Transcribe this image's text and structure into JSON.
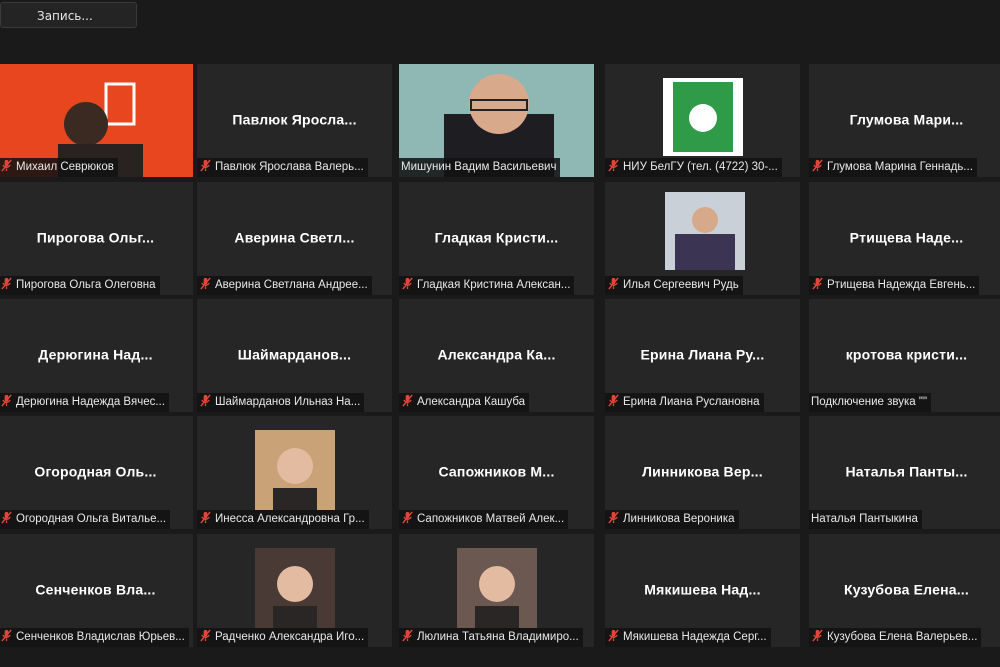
{
  "toolbar": {
    "record_label": "Запись..."
  },
  "colors": {
    "active_speaker": "#bfe23a",
    "tile_bg": "#262626",
    "page_bg": "#1a1a1a",
    "muted_mic": "#e0473a"
  },
  "tiles": [
    {
      "big": "",
      "label": "Михаил Севрюков",
      "muted": true,
      "video": "orange"
    },
    {
      "big": "Павлюк Яросла...",
      "label": "Павлюк Ярослава Валерь...",
      "muted": true
    },
    {
      "big": "",
      "label": "Мишунин Вадим Васильевич",
      "muted": false,
      "video": "teal",
      "active": true
    },
    {
      "big": "",
      "label": "НИУ БелГУ (тел. (4722) 30-...",
      "muted": true,
      "video": "logo"
    },
    {
      "big": "Глумова Мари...",
      "label": "Глумова Марина Геннадь...",
      "muted": true
    },
    {
      "big": "Пирогова Ольг...",
      "label": "Пирогова Ольга Олеговна",
      "muted": true
    },
    {
      "big": "Аверина Светл...",
      "label": "Аверина Светлана Андрее...",
      "muted": true
    },
    {
      "big": "Гладкая Кристи...",
      "label": "Гладкая Кристина Алексан...",
      "muted": true
    },
    {
      "big": "",
      "label": "Илья Сергеевич Рудь",
      "muted": true,
      "video": "office"
    },
    {
      "big": "Ртищева Наде...",
      "label": "Ртищева Надежда Евгень...",
      "muted": true
    },
    {
      "big": "Дерюгина Над...",
      "label": "Дерюгина Надежда Вячес...",
      "muted": true
    },
    {
      "big": "Шаймарданов...",
      "label": "Шаймарданов Ильназ На...",
      "muted": true
    },
    {
      "big": "Александра Ка...",
      "label": "Александра Кашуба",
      "muted": true
    },
    {
      "big": "Ерина Лиана Ру...",
      "label": "Ерина Лиана Руслановна",
      "muted": true
    },
    {
      "big": "кротова кристи...",
      "label": "Подключение звука \"\"",
      "muted": false
    },
    {
      "big": "Огородная Оль...",
      "label": "Огородная Ольга Виталье...",
      "muted": true
    },
    {
      "big": "",
      "label": "Инесса Александровна Гр...",
      "muted": true,
      "video": "photo1"
    },
    {
      "big": "Сапожников М...",
      "label": "Сапожников Матвей Алек...",
      "muted": true
    },
    {
      "big": "Линникова Вер...",
      "label": "Линникова Вероника",
      "muted": true
    },
    {
      "big": "Наталья Панты...",
      "label": "Наталья Пантыкина",
      "muted": false
    },
    {
      "big": "Сенченков Вла...",
      "label": "Сенченков Владислав Юрьев...",
      "muted": true
    },
    {
      "big": "",
      "label": "Радченко Александра Иго...",
      "muted": true,
      "video": "photo2"
    },
    {
      "big": "",
      "label": "Люлина Татьяна Владимиро...",
      "muted": true,
      "video": "photo3"
    },
    {
      "big": "Мякишева Над...",
      "label": "Мякишева Надежда Серг...",
      "muted": true
    },
    {
      "big": "Кузубова Елена...",
      "label": "Кузубова Елена Валерьев...",
      "muted": true
    }
  ]
}
